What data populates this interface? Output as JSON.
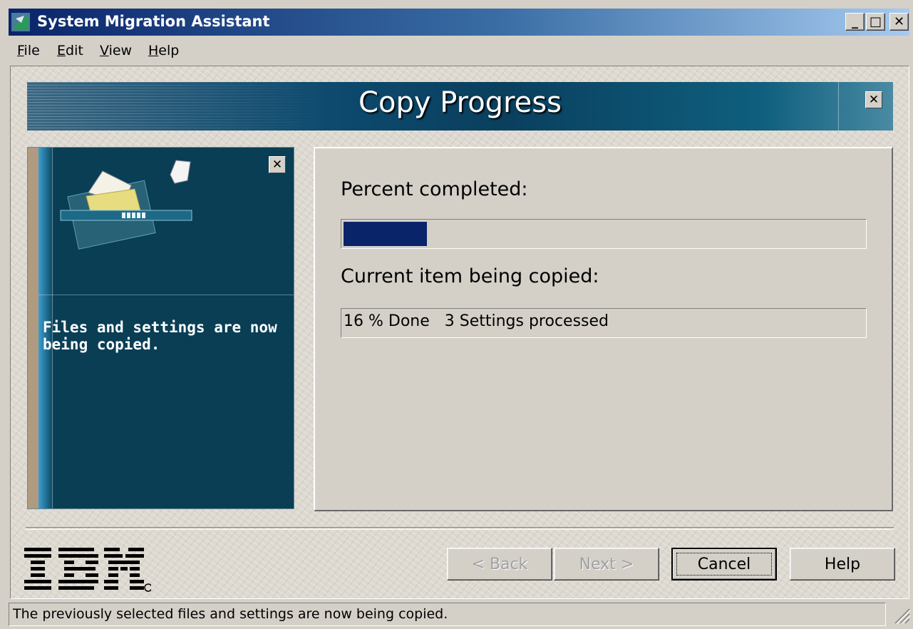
{
  "window": {
    "title": "System Migration Assistant",
    "controls": {
      "minimize": "_",
      "maximize": "□",
      "close": "✕"
    }
  },
  "menu": [
    "File",
    "Edit",
    "View",
    "Help"
  ],
  "banner": {
    "title": "Copy Progress",
    "close": "✕"
  },
  "side_panel": {
    "close": "✕",
    "message": "Files and settings are now being copied.",
    "icon": "folder-transfer-icon"
  },
  "main": {
    "percent_label": "Percent completed:",
    "progress": {
      "percent": 16,
      "color": "#0a246a"
    },
    "current_label": "Current item being copied:",
    "current_status": "16 % Done   3 Settings processed"
  },
  "logo": {
    "name": "ibm-logo",
    "text": "IBM",
    "mark": "®"
  },
  "buttons": {
    "back": "< Back",
    "next": "Next >",
    "cancel": "Cancel",
    "help": "Help"
  },
  "status_bar": "The previously selected files and settings are now being copied.",
  "colors": {
    "titlebar_start": "#0a246a",
    "titlebar_end": "#a6caf0",
    "panel_bg": "#093e55",
    "face": "#d4d0c8"
  }
}
